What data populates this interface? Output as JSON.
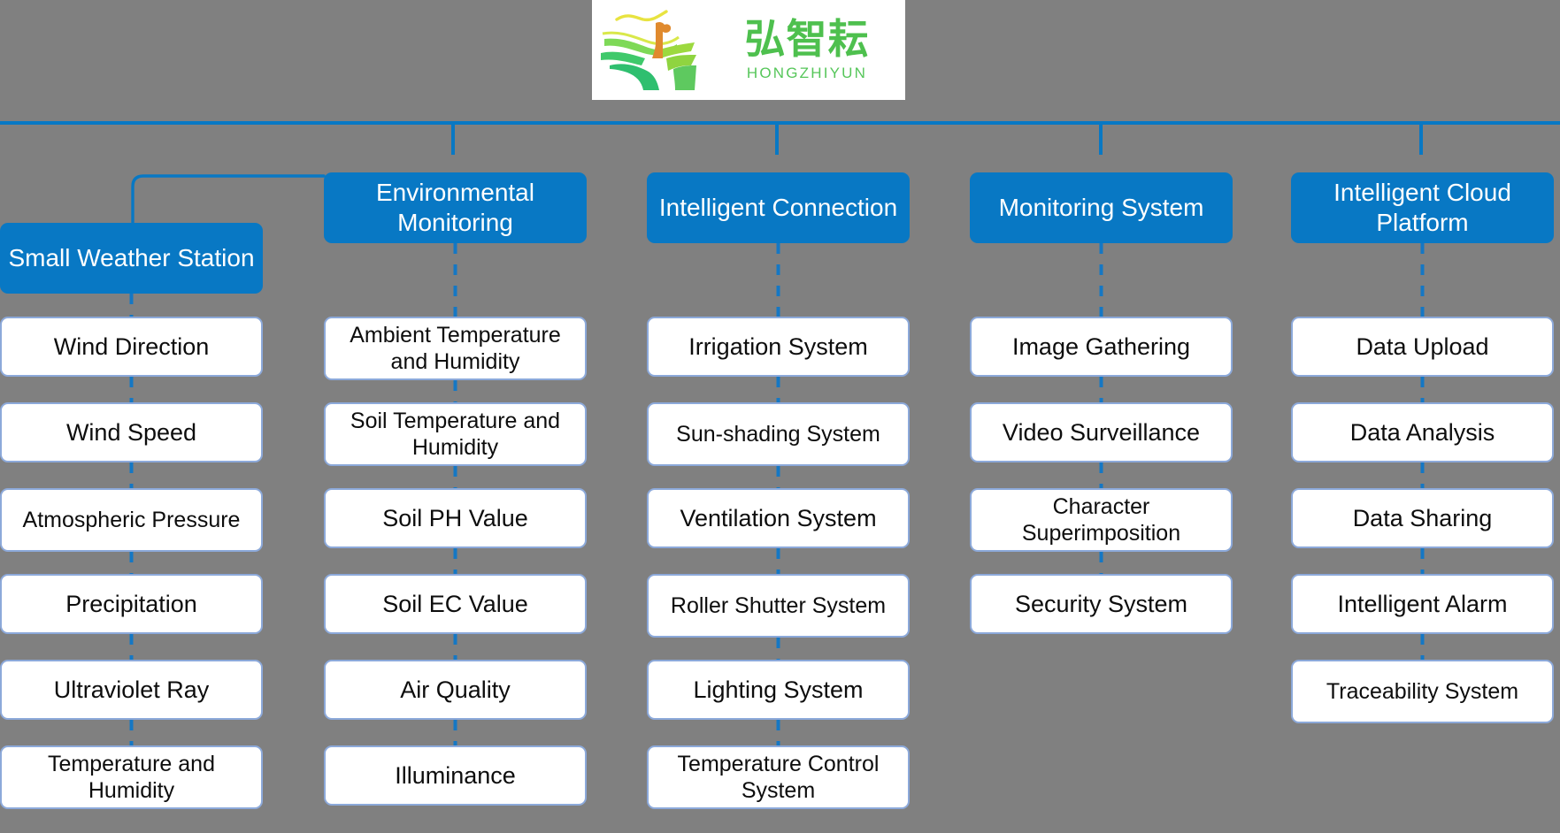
{
  "meta": {
    "background_color": "#808080",
    "accent_blue": "#0878C4",
    "leaf_border": "#8CA9DA",
    "leaf_fill": "#FFFFFF",
    "logo_green": "#4EC04E"
  },
  "logo": {
    "name": "hongzhiyun-logo",
    "chinese_text": "弘智耘",
    "latin_text": "HONGZHIYUN",
    "background": "#FFFFFF",
    "mark_description": "green-terraced-field-with-orange-figure"
  },
  "columns": [
    {
      "id": "small-weather-station",
      "header": "Small Weather Station",
      "items": [
        "Wind Direction",
        "Wind Speed",
        "Atmospheric Pressure",
        "Precipitation",
        "Ultraviolet Ray",
        "Temperature and Humidity"
      ]
    },
    {
      "id": "environmental-monitoring",
      "header": "Environmental Monitoring",
      "items": [
        "Ambient Temperature and Humidity",
        "Soil Temperature and Humidity",
        "Soil PH Value",
        "Soil EC Value",
        "Air Quality",
        "Illuminance"
      ]
    },
    {
      "id": "intelligent-connection",
      "header": "Intelligent Connection",
      "items": [
        "Irrigation System",
        "Sun-shading System",
        "Ventilation System",
        "Roller Shutter System",
        "Lighting System",
        "Temperature Control System"
      ]
    },
    {
      "id": "monitoring-system",
      "header": "Monitoring System",
      "items": [
        "Image Gathering",
        "Video Surveillance",
        "Character Superimposition",
        "Security System"
      ]
    },
    {
      "id": "intelligent-cloud-platform",
      "header": "Intelligent Cloud Platform",
      "items": [
        "Data Upload",
        "Data Analysis",
        "Data Sharing",
        "Intelligent Alarm",
        "Traceability System"
      ]
    }
  ]
}
